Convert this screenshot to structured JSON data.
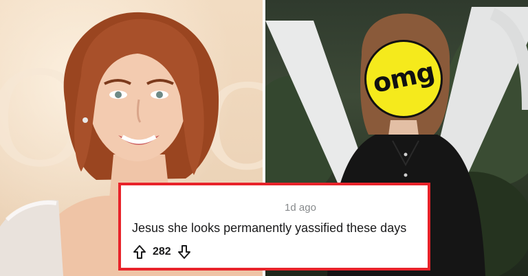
{
  "badge": {
    "text": "omg",
    "color": "#f5ea1c"
  },
  "comment": {
    "timestamp": "1d ago",
    "body": "Jesus she looks permanently yassified these days",
    "vote_count": "282",
    "border_color": "#e8232a"
  },
  "icons": {
    "upvote": "arrow-up-icon",
    "downvote": "arrow-down-icon"
  }
}
